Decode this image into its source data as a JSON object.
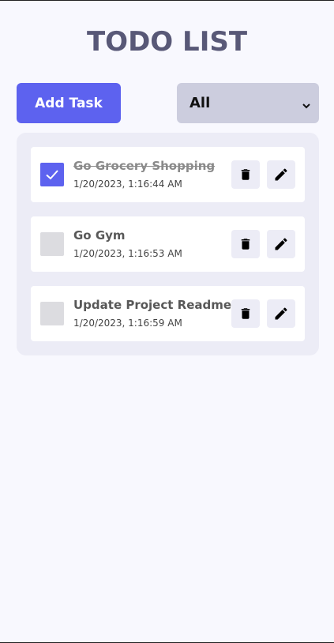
{
  "app": {
    "title": "TODO LIST"
  },
  "toolbar": {
    "add_label": "Add Task",
    "filter": {
      "selected": "All"
    }
  },
  "todos": [
    {
      "title": "Go Grocery Shopping",
      "time": "1/20/2023, 1:16:44 AM",
      "completed": true
    },
    {
      "title": "Go Gym",
      "time": "1/20/2023, 1:16:53 AM",
      "completed": false
    },
    {
      "title": "Update Project Readme",
      "time": "1/20/2023, 1:16:59 AM",
      "completed": false
    }
  ],
  "colors": {
    "accent": "#5d62ef",
    "title": "#585877",
    "panel": "#ececf6",
    "background": "#f8f8fe",
    "select": "#cccdde"
  },
  "icons": {
    "delete": "trash-icon",
    "edit": "pencil-icon",
    "check": "check-icon"
  }
}
